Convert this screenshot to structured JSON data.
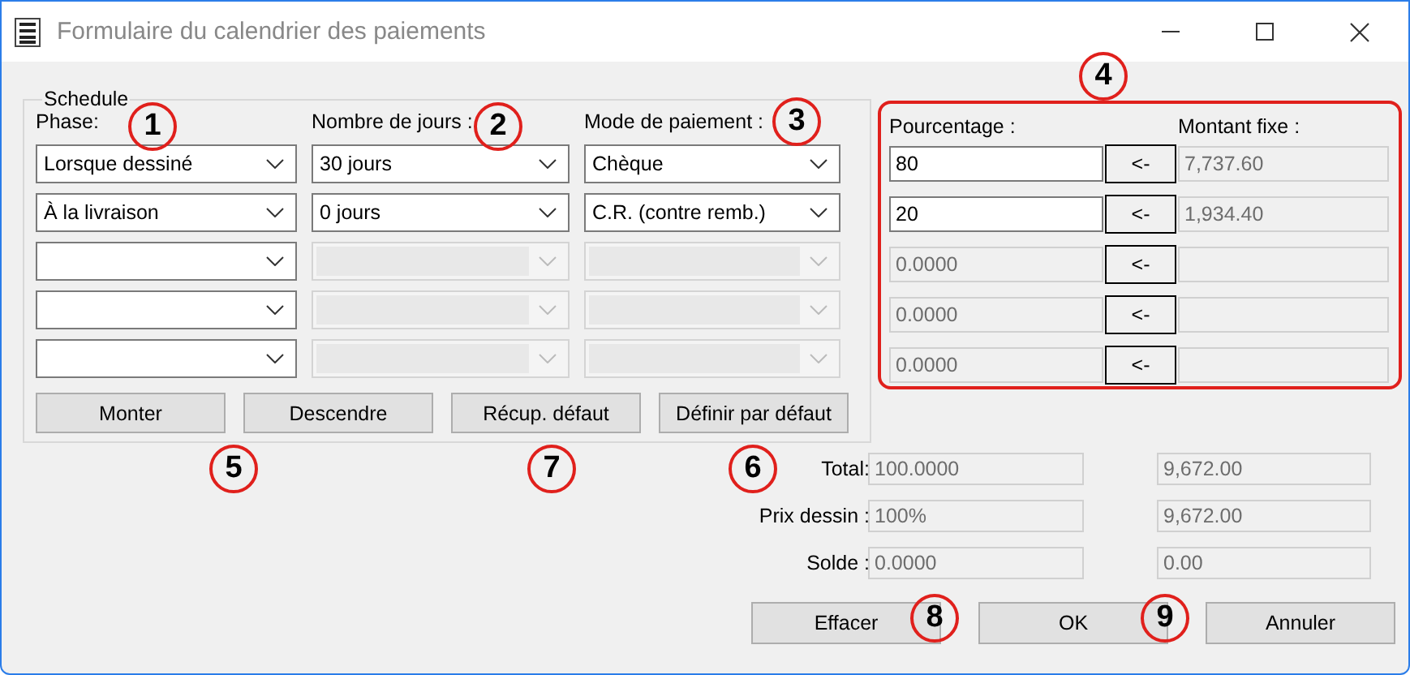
{
  "window": {
    "title": "Formulaire du calendrier des paiements"
  },
  "schedule": {
    "title": "Schedule",
    "columns": [
      "Phase:",
      "Nombre de jours :",
      "Mode de paiement :"
    ],
    "rows": [
      {
        "phase": "Lorsque dessiné",
        "days": "30 jours",
        "payment": "Chèque",
        "days_disabled": false,
        "payment_disabled": false
      },
      {
        "phase": "À la livraison",
        "days": "0 jours",
        "payment": "C.R. (contre remb.)",
        "days_disabled": false,
        "payment_disabled": false
      },
      {
        "days_disabled": true,
        "payment_disabled": true
      },
      {
        "days_disabled": true,
        "payment_disabled": true
      },
      {
        "days_disabled": true,
        "payment_disabled": true
      }
    ]
  },
  "schedule_buttons": [
    "Monter",
    "Descendre",
    "Récup. défaut",
    "Définir par défaut"
  ],
  "amounts": {
    "columns": [
      "Pourcentage :",
      "Montant fixe :"
    ],
    "rows": [
      {
        "percentage": "80",
        "percentage_disabled": false,
        "apply_label": "<-",
        "fixed_amount": "7,737.60"
      },
      {
        "percentage": "20",
        "percentage_disabled": false,
        "apply_label": "<-",
        "fixed_amount": "1,934.40"
      },
      {
        "percentage": "0.0000",
        "percentage_disabled": true,
        "apply_label": "<-"
      },
      {
        "percentage": "0.0000",
        "percentage_disabled": true,
        "apply_label": "<-"
      },
      {
        "percentage": "0.0000",
        "percentage_disabled": true,
        "apply_label": "<-"
      }
    ]
  },
  "totals": [
    {
      "label": "Total:",
      "percentage": "100.0000",
      "amount": "9,672.00"
    },
    {
      "label": "Prix dessin :",
      "percentage": "100%",
      "amount": "9,672.00"
    },
    {
      "label": "Solde :",
      "percentage": "0.0000",
      "amount": "0.00"
    }
  ],
  "buttons": [
    "Effacer",
    "OK",
    "Annuler"
  ],
  "callouts": [
    "1",
    "2",
    "3",
    "4",
    "5",
    "7",
    "6",
    "8",
    "9"
  ]
}
